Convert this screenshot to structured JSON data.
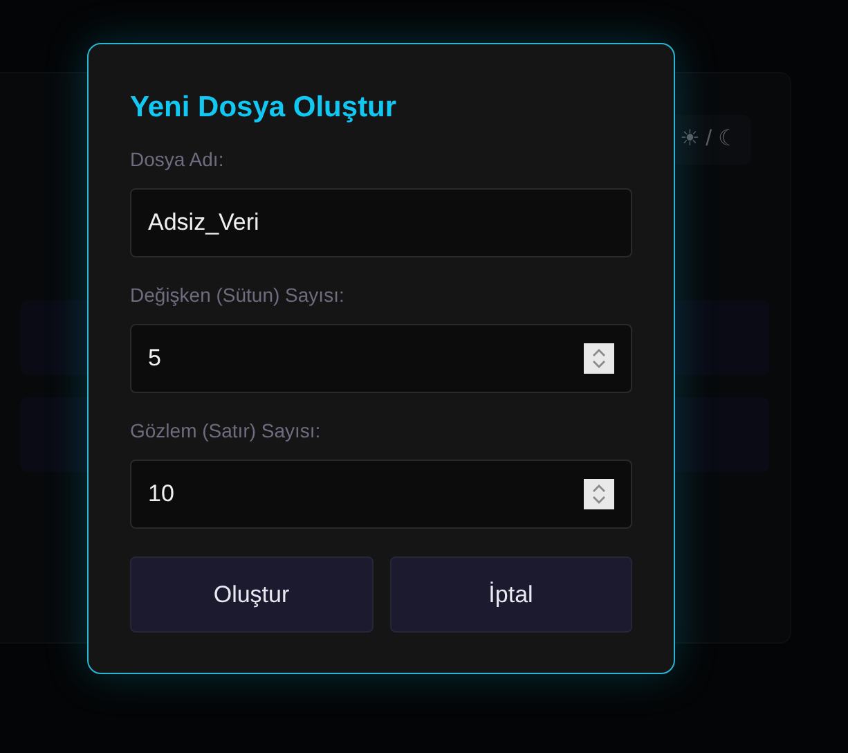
{
  "background": {
    "theme_toggle": "☀ / ☾"
  },
  "dialog": {
    "title": "Yeni Dosya Oluştur",
    "fields": [
      {
        "label": "Dosya Adı:",
        "value": "Adsiz_Veri",
        "kind": "text"
      },
      {
        "label": "Değişken (Sütun) Sayısı:",
        "value": "5",
        "kind": "number"
      },
      {
        "label": "Gözlem (Satır) Sayısı:",
        "value": "10",
        "kind": "number"
      }
    ],
    "buttons": [
      "Oluştur",
      "İptal"
    ]
  }
}
